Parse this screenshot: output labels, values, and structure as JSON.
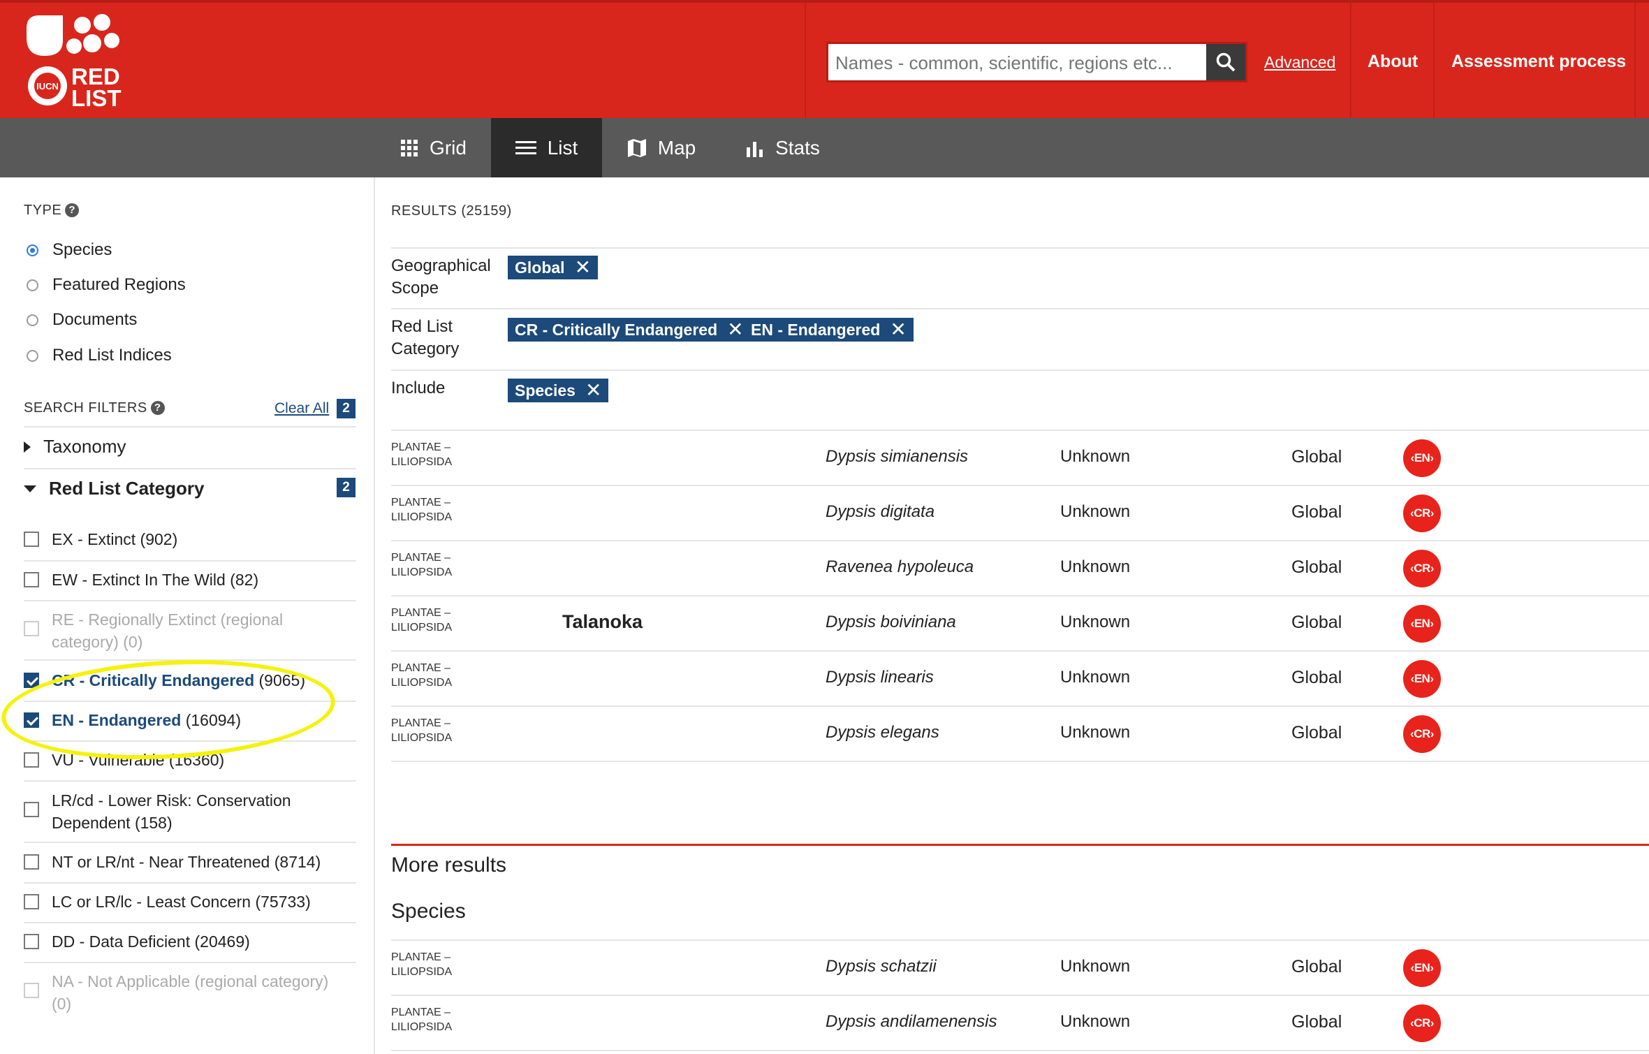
{
  "brand": {
    "line1": "RED",
    "line2": "LIST",
    "emblem": "IUCN",
    "colors": {
      "header": "#d9261c",
      "chip": "#1c4a7a",
      "status": "#e8231b"
    }
  },
  "header": {
    "search_placeholder": "Names - common, scientific, regions etc...",
    "advanced": "Advanced",
    "about": "About",
    "assessment": "Assessment process"
  },
  "views": [
    {
      "label": "Grid",
      "icon": "grid-icon"
    },
    {
      "label": "List",
      "icon": "list-icon"
    },
    {
      "label": "Map",
      "icon": "map-icon"
    },
    {
      "label": "Stats",
      "icon": "stats-icon"
    }
  ],
  "sidebar": {
    "type_label": "TYPE",
    "types": [
      "Species",
      "Featured Regions",
      "Documents",
      "Red List Indices"
    ],
    "filters_label": "SEARCH FILTERS",
    "clear_all": "Clear All",
    "filter_count": "2",
    "taxonomy": "Taxonomy",
    "red_list_category": "Red List Category",
    "category_count": "2",
    "categories": [
      {
        "code": "EX - Extinct",
        "count": "(902)"
      },
      {
        "code": "EW - Extinct In The Wild",
        "count": "(82)"
      },
      {
        "code": "RE - Regionally Extinct (regional category)",
        "count": "(0)"
      },
      {
        "code": "CR - Critically Endangered",
        "count": "(9065)"
      },
      {
        "code": "EN - Endangered",
        "count": "(16094)"
      },
      {
        "code": "VU - Vulnerable",
        "count": "(16360)"
      },
      {
        "code": "LR/cd - Lower Risk: Conservation Dependent",
        "count": "(158)"
      },
      {
        "code": "NT or LR/nt - Near Threatened",
        "count": "(8714)"
      },
      {
        "code": "LC or LR/lc - Least Concern",
        "count": "(75733)"
      },
      {
        "code": "DD - Data Deficient",
        "count": "(20469)"
      },
      {
        "code": "NA - Not Applicable (regional category)",
        "count": "(0)"
      }
    ]
  },
  "main": {
    "results": "RESULTS (25159)",
    "filters": [
      {
        "label": "Geographical Scope",
        "chips": [
          "Global"
        ]
      },
      {
        "label": "Red List Category",
        "chips": [
          "CR - Critically Endangered",
          "EN - Endangered"
        ]
      },
      {
        "label": "Include",
        "chips": [
          "Species"
        ]
      }
    ],
    "rows": [
      {
        "kingdom": "PLANTAE –",
        "class": "LILIOPSIDA",
        "common": "",
        "scientific": "Dypsis simianensis",
        "trend": "Unknown",
        "scope": "Global",
        "status": "EN"
      },
      {
        "kingdom": "PLANTAE –",
        "class": "LILIOPSIDA",
        "common": "",
        "scientific": "Dypsis digitata",
        "trend": "Unknown",
        "scope": "Global",
        "status": "CR"
      },
      {
        "kingdom": "PLANTAE –",
        "class": "LILIOPSIDA",
        "common": "",
        "scientific": "Ravenea hypoleuca",
        "trend": "Unknown",
        "scope": "Global",
        "status": "CR"
      },
      {
        "kingdom": "PLANTAE –",
        "class": "LILIOPSIDA",
        "common": "Talanoka",
        "scientific": "Dypsis boiviniana",
        "trend": "Unknown",
        "scope": "Global",
        "status": "EN"
      },
      {
        "kingdom": "PLANTAE –",
        "class": "LILIOPSIDA",
        "common": "",
        "scientific": "Dypsis linearis",
        "trend": "Unknown",
        "scope": "Global",
        "status": "EN"
      },
      {
        "kingdom": "PLANTAE –",
        "class": "LILIOPSIDA",
        "common": "",
        "scientific": "Dypsis elegans",
        "trend": "Unknown",
        "scope": "Global",
        "status": "CR"
      }
    ],
    "more_results": "More results",
    "species_heading": "Species",
    "more_rows": [
      {
        "kingdom": "PLANTAE –",
        "class": "LILIOPSIDA",
        "common": "",
        "scientific": "Dypsis schatzii",
        "trend": "Unknown",
        "scope": "Global",
        "status": "EN"
      },
      {
        "kingdom": "PLANTAE –",
        "class": "LILIOPSIDA",
        "common": "",
        "scientific": "Dypsis andilamenensis",
        "trend": "Unknown",
        "scope": "Global",
        "status": "CR"
      }
    ]
  }
}
